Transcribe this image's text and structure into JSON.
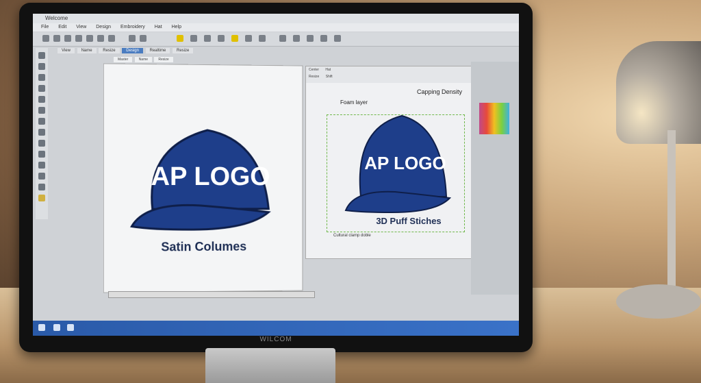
{
  "window": {
    "title": "Welcome"
  },
  "menu": {
    "items": [
      "File",
      "Edit",
      "View",
      "Design",
      "Embroidery",
      "Hat",
      "Help"
    ]
  },
  "tabs": {
    "primary": [
      "View",
      "Name",
      "Resize",
      "Design",
      "Realtime",
      "Resize"
    ],
    "secondary": [
      "Master",
      "Name",
      "Resize"
    ]
  },
  "left_canvas": {
    "cap_text": "AP LOGO",
    "caption": "Satin Columes"
  },
  "right_canvas": {
    "header": {
      "row1": [
        "Center",
        "Hat"
      ],
      "row2": [
        "Resize",
        "Shift"
      ]
    },
    "cap_text": "AP LOGO",
    "annotations": {
      "top": "Capping Density",
      "left": "Foam layer",
      "bottom": "3D Puff Stiches",
      "footer": "Cultural clamp doble"
    }
  },
  "monitor": {
    "brand": "WILCOM"
  },
  "colors": {
    "accent": "#4a7cc0",
    "cap_navy": "#1e3e8a",
    "guide_green": "#6fb84a"
  }
}
